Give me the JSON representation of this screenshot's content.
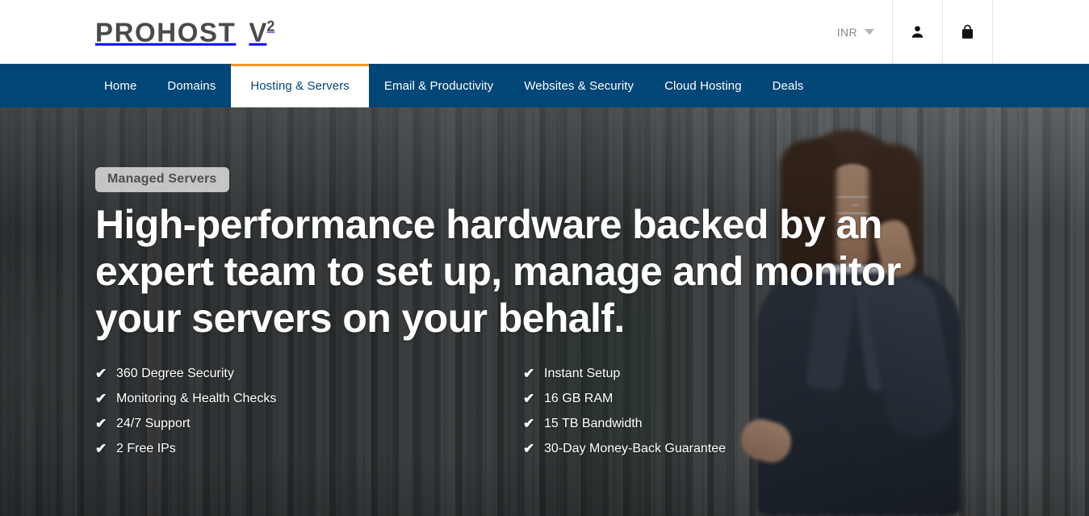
{
  "header": {
    "brand": {
      "name": "PROHOST",
      "v": "V",
      "superscript": "2"
    },
    "currency": {
      "label": "INR",
      "icon": "chevron-down-icon"
    },
    "account_icon": "user-icon",
    "cart_icon": "shopping-bag-icon"
  },
  "nav": {
    "items": [
      {
        "label": "Home",
        "active": false
      },
      {
        "label": "Domains",
        "active": false
      },
      {
        "label": "Hosting & Servers",
        "active": true
      },
      {
        "label": "Email & Productivity",
        "active": false
      },
      {
        "label": "Websites & Security",
        "active": false
      },
      {
        "label": "Cloud Hosting",
        "active": false
      },
      {
        "label": "Deals",
        "active": false
      }
    ]
  },
  "hero": {
    "badge": "Managed Servers",
    "headline": "High-performance hardware backed by an expert team to set up, manage and monitor your servers on your behalf.",
    "check_glyph": "✔",
    "features_left": [
      "360 Degree Security",
      "Monitoring & Health Checks",
      "24/7 Support",
      "2 Free IPs"
    ],
    "features_right": [
      "Instant Setup",
      "16 GB RAM",
      "15 TB Bandwidth",
      "30-Day Money-Back Guarantee"
    ]
  },
  "colors": {
    "nav_navy": "#004677",
    "accent_orange": "#f89728",
    "brand_gray": "#4a4a4a",
    "badge_bg": "#e8e8e8"
  }
}
